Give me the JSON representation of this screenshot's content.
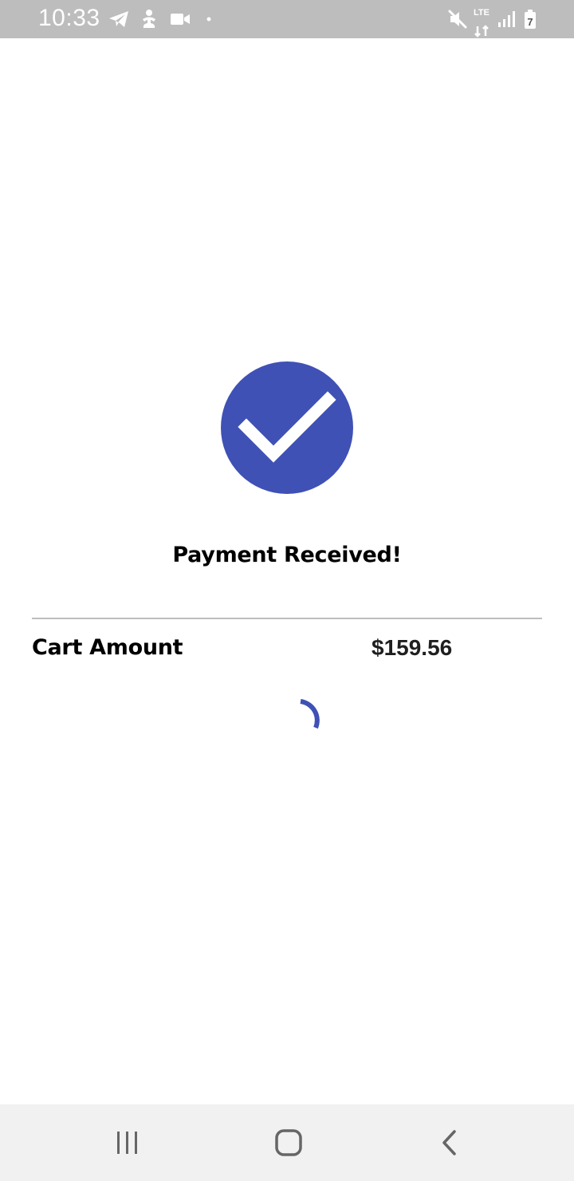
{
  "status_bar": {
    "time": "10:33",
    "network_label": "LTE",
    "battery_label": "7",
    "icons": [
      "telegram-icon",
      "accessibility-icon",
      "video-camera-icon",
      "dot-icon",
      "mute-icon",
      "lte-data-icon",
      "signal-icon",
      "battery-icon"
    ]
  },
  "payment": {
    "title": "Payment Received!",
    "status_icon": "check-circle-icon",
    "accent_color": "#3f51b5"
  },
  "cart": {
    "label": "Cart Amount",
    "amount": "$159.56"
  },
  "loader": {
    "icon": "loading-spinner-icon"
  },
  "nav_bar": {
    "recents_icon": "recents-icon",
    "home_icon": "home-icon",
    "back_icon": "back-icon"
  }
}
